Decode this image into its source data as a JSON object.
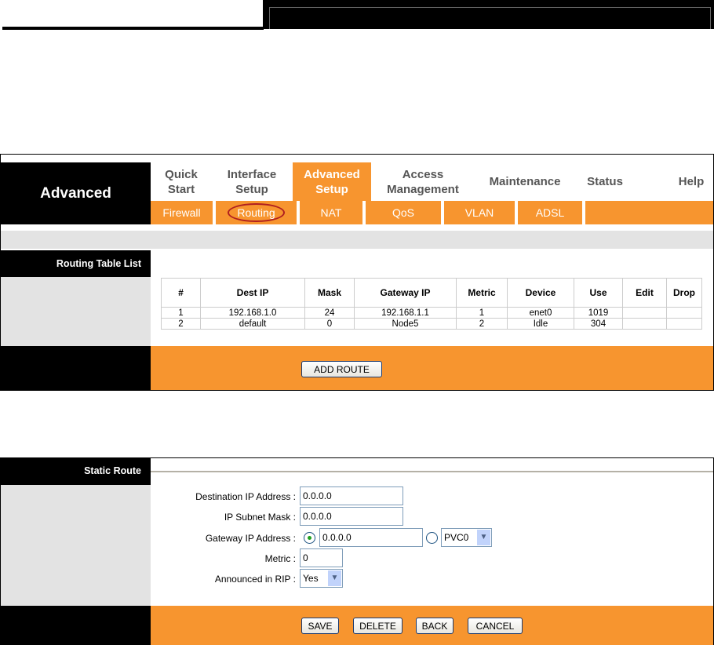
{
  "header": {
    "section": "Advanced"
  },
  "nav": {
    "top": [
      {
        "label": "Quick\nStart"
      },
      {
        "label": "Interface\nSetup"
      },
      {
        "label": "Advanced\nSetup"
      },
      {
        "label": "Access\nManagement"
      },
      {
        "label": "Maintenance"
      },
      {
        "label": "Status"
      },
      {
        "label": "Help"
      }
    ],
    "sub": [
      "Firewall",
      "Routing",
      "NAT",
      "QoS",
      "VLAN",
      "ADSL"
    ]
  },
  "routing": {
    "title": "Routing Table List",
    "columns": [
      "#",
      "Dest IP",
      "Mask",
      "Gateway IP",
      "Metric",
      "Device",
      "Use",
      "Edit",
      "Drop"
    ],
    "rows": [
      [
        "1",
        "192.168.1.0",
        "24",
        "192.168.1.1",
        "1",
        "enet0",
        "1019",
        "",
        ""
      ],
      [
        "2",
        "default",
        "0",
        "Node5",
        "2",
        "Idle",
        "304",
        "",
        ""
      ]
    ],
    "add_label": "ADD ROUTE"
  },
  "static": {
    "title": "Static Route",
    "dest_label": "Destination IP Address :",
    "dest_value": "0.0.0.0",
    "mask_label": "IP Subnet Mask :",
    "mask_value": "0.0.0.0",
    "gw_label": "Gateway IP Address :",
    "gw_value": "0.0.0.0",
    "gw_pvc": "PVC0",
    "metric_label": "Metric :",
    "metric_value": "0",
    "rip_label": "Announced in RIP :",
    "rip_value": "Yes",
    "buttons": [
      "SAVE",
      "DELETE",
      "BACK",
      "CANCEL"
    ]
  },
  "colors": {
    "accent": "#f7952f",
    "bar": "#000000"
  }
}
